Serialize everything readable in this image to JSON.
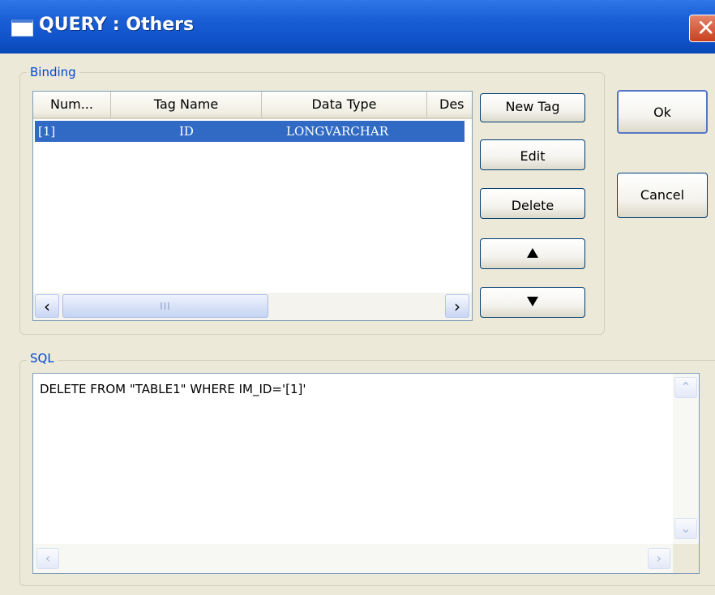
{
  "window": {
    "title": "QUERY : Others"
  },
  "binding": {
    "group_label": "Binding",
    "columns": [
      "Num...",
      "Tag Name",
      "Data Type",
      "Des"
    ],
    "rows": [
      {
        "num": "[1]",
        "tag_name": "ID",
        "data_type": "LONGVARCHAR",
        "selected": true
      }
    ],
    "scroll_grip": "III"
  },
  "buttons": {
    "new_tag": "New Tag",
    "edit": "Edit",
    "delete": "Delete",
    "ok": "Ok",
    "cancel": "Cancel"
  },
  "icons": {
    "move_up": "triangle-up-icon",
    "move_down": "triangle-down-icon",
    "scroll_left": "chevron-left-icon",
    "scroll_right": "chevron-right-icon",
    "scroll_up": "chevron-up-icon",
    "scroll_down": "chevron-down-icon"
  },
  "sql": {
    "group_label": "SQL",
    "text": "DELETE FROM \"TABLE1\" WHERE IM_ID='[1]'"
  },
  "colors": {
    "titlebar": "#0f52c9",
    "selection": "#316ac5",
    "group_label": "#0046d5",
    "dialog_bg": "#ece9d8"
  }
}
